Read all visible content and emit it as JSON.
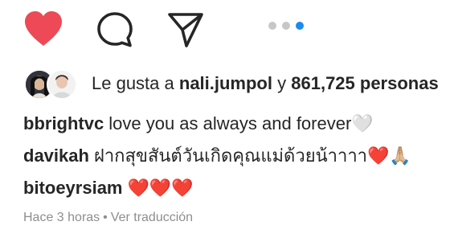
{
  "actions": {
    "like_icon": "heart-filled-icon",
    "comment_icon": "comment-icon",
    "share_icon": "paper-plane-icon",
    "like_color": "#ed4956",
    "carousel_active_color": "#1a8cf0",
    "carousel_inactive_color": "#c7c7c7"
  },
  "likes": {
    "prefix": "Le gusta a",
    "user": "nali.jumpol",
    "conjunction": "y",
    "count_text": "861,725 personas"
  },
  "comments": [
    {
      "user": "bbrightvc",
      "text": "love you as always and forever🤍"
    },
    {
      "user": "davikah",
      "text": "ฝากสุขสันต์วันเกิดคุณแม่ด้วยน้าาาา❤️🙏🏼"
    },
    {
      "user": "bitoeyrsiam",
      "text": "❤️❤️❤️"
    }
  ],
  "meta": {
    "time": "Hace 3 horas",
    "separator": "•",
    "translate": "Ver traducción"
  }
}
